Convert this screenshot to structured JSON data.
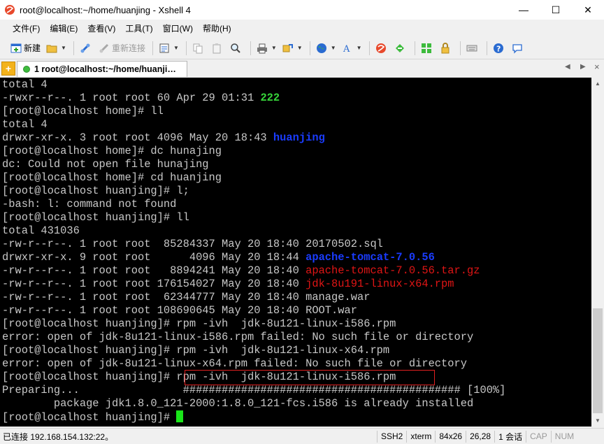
{
  "window": {
    "title": "root@localhost:~/home/huanjing - Xshell 4",
    "app_icon": "xshell-icon",
    "controls": {
      "minimize": "—",
      "maximize": "☐",
      "close": "✕"
    }
  },
  "menu": {
    "items": [
      "文件(F)",
      "编辑(E)",
      "查看(V)",
      "工具(T)",
      "窗口(W)",
      "帮助(H)"
    ]
  },
  "toolbar": {
    "new_label": "新建",
    "reconnect_label": "重新连接"
  },
  "tabs": {
    "add_label": "+",
    "active_label": "1 root@localhost:~/home/huanji…",
    "close_label": "×",
    "prev_label": "◀",
    "next_label": "▶"
  },
  "terminal": {
    "lines": [
      [
        {
          "t": "total 4"
        }
      ],
      [
        {
          "t": "-rwxr--r--. 1 root root 60 Apr 29 01:31 "
        },
        {
          "t": "222",
          "c": "green"
        }
      ],
      [
        {
          "t": "[root@localhost home]# ll"
        }
      ],
      [
        {
          "t": "total 4"
        }
      ],
      [
        {
          "t": "drwxr-xr-x. 3 root root 4096 May 20 18:43 "
        },
        {
          "t": "huanjing",
          "c": "blue"
        }
      ],
      [
        {
          "t": "[root@localhost home]# dc hunajing"
        }
      ],
      [
        {
          "t": "dc: Could not open file hunajing"
        }
      ],
      [
        {
          "t": "[root@localhost home]# cd huanjing"
        }
      ],
      [
        {
          "t": "[root@localhost huanjing]# l;"
        }
      ],
      [
        {
          "t": "-bash: l: command not found"
        }
      ],
      [
        {
          "t": "[root@localhost huanjing]# ll"
        }
      ],
      [
        {
          "t": "total 431036"
        }
      ],
      [
        {
          "t": "-rw-r--r--. 1 root root  85284337 May 20 18:40 20170502.sql"
        }
      ],
      [
        {
          "t": "drwxr-xr-x. 9 root root      4096 May 20 18:44 "
        },
        {
          "t": "apache-tomcat-7.0.56",
          "c": "blue"
        }
      ],
      [
        {
          "t": "-rw-r--r--. 1 root root   8894241 May 20 18:40 "
        },
        {
          "t": "apache-tomcat-7.0.56.tar.gz",
          "c": "red"
        }
      ],
      [
        {
          "t": "-rw-r--r--. 1 root root 176154027 May 20 18:40 "
        },
        {
          "t": "jdk-8u191-linux-x64.rpm",
          "c": "red"
        }
      ],
      [
        {
          "t": "-rw-r--r--. 1 root root  62344777 May 20 18:40 manage.war"
        }
      ],
      [
        {
          "t": "-rw-r--r--. 1 root root 108690645 May 20 18:40 ROOT.war"
        }
      ],
      [
        {
          "t": "[root@localhost huanjing]# rpm -ivh  jdk-8u121-linux-i586.rpm"
        }
      ],
      [
        {
          "t": "error: open of jdk-8u121-linux-i586.rpm failed: No such file or directory"
        }
      ],
      [
        {
          "t": "[root@localhost huanjing]# rpm -ivh  jdk-8u121-linux-x64.rpm"
        }
      ],
      [
        {
          "t": "error: open of jdk-8u121-linux-x64.rpm failed: No such file or directory"
        }
      ],
      [
        {
          "t": "[root@localhost huanjing]# rpm -ivh  jdk-8u121-linux-i586.rpm"
        }
      ],
      [
        {
          "t": "Preparing...                ########################################### [100%]"
        }
      ],
      [
        {
          "t": "        package jdk1.8.0_121-2000:1.8.0_121-fcs.i586 is already installed"
        }
      ],
      [
        {
          "t": "[root@localhost huanjing]# "
        },
        {
          "t": "",
          "c": "cursor"
        }
      ]
    ]
  },
  "status": {
    "connection": "已连接 192.168.154.132:22。",
    "protocol": "SSH2",
    "term_type": "xterm",
    "size": "84x26",
    "position": "26,28",
    "sessions": "1 会话",
    "cap": "CAP",
    "num": "NUM"
  },
  "colors": {
    "terminal_bg": "#000000",
    "terminal_fg": "#c8c8c8",
    "ls_executable": "#37d63a",
    "ls_directory": "#1a3cff",
    "ls_archive": "#e01515",
    "cursor": "#19e619",
    "highlight_box": "#e02020"
  }
}
